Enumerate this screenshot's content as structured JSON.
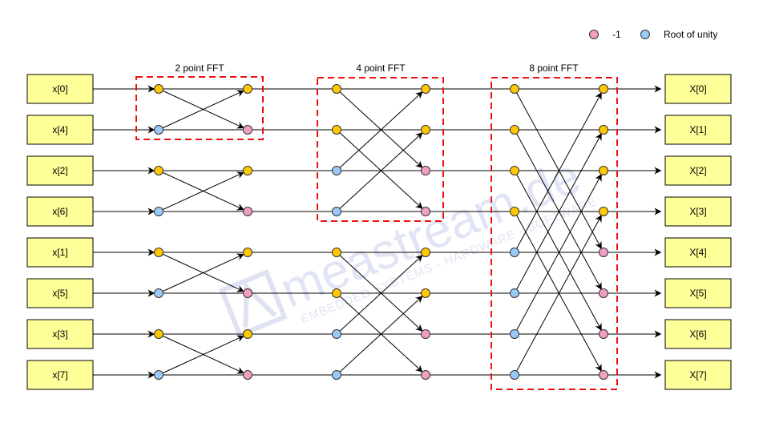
{
  "legend": {
    "items": [
      {
        "label": "-1",
        "color": "#f19ec2",
        "meaning": "negative-one"
      },
      {
        "label": "Root of unity",
        "color": "#99c9f7",
        "meaning": "root-of-unity"
      }
    ]
  },
  "colors": {
    "input_box_fill": "#ffff99",
    "neutral_node": "#ffc800",
    "minus_one_node": "#f19ec2",
    "root_of_unity_node": "#99c9f7",
    "stage_border": "#ee1111",
    "line": "#000000",
    "watermark": "#d3d8f0"
  },
  "stages": [
    {
      "label": "2 point FFT"
    },
    {
      "label": "4 point FFT"
    },
    {
      "label": "8 point FFT"
    }
  ],
  "inputs": [
    "x[0]",
    "x[4]",
    "x[2]",
    "x[6]",
    "x[1]",
    "x[5]",
    "x[3]",
    "x[7]"
  ],
  "outputs": [
    "X[0]",
    "X[1]",
    "X[2]",
    "X[3]",
    "X[4]",
    "X[5]",
    "X[6]",
    "X[7]"
  ],
  "node_types": {
    "stage1_left": [
      "neutral",
      "root",
      "neutral",
      "root",
      "neutral",
      "root",
      "neutral",
      "root"
    ],
    "stage1_right": [
      "neutral",
      "minus",
      "neutral",
      "minus",
      "neutral",
      "minus",
      "neutral",
      "minus"
    ],
    "stage2_left": [
      "neutral",
      "neutral",
      "root",
      "root",
      "neutral",
      "neutral",
      "root",
      "root"
    ],
    "stage2_right": [
      "neutral",
      "neutral",
      "minus",
      "minus",
      "neutral",
      "neutral",
      "minus",
      "minus"
    ],
    "stage3_left": [
      "neutral",
      "neutral",
      "neutral",
      "neutral",
      "root",
      "root",
      "root",
      "root"
    ],
    "stage3_right": [
      "neutral",
      "neutral",
      "neutral",
      "neutral",
      "minus",
      "minus",
      "minus",
      "minus"
    ]
  },
  "watermark": {
    "brand": "meastream.de",
    "tagline": "EMBEDDED SYSTEMS - HARDWARE - SOFTWARE"
  }
}
